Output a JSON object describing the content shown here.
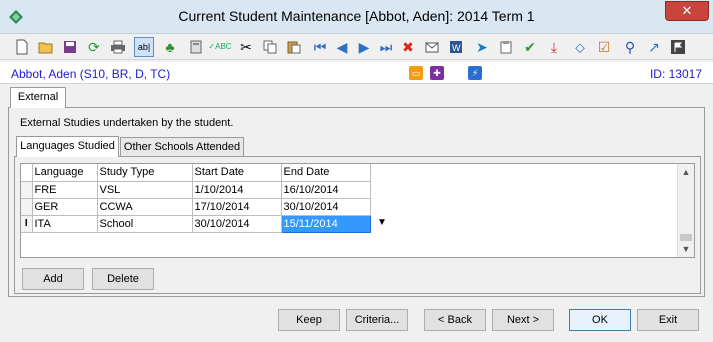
{
  "window": {
    "title": "Current Student Maintenance  [Abbot, Aden]:  2014 Term 1",
    "close_label": "✕"
  },
  "toolbar": {
    "icons": [
      "new-icon",
      "open-icon",
      "save-icon",
      "refresh-icon",
      "print-icon",
      "field-icon",
      "tree-icon",
      "calculator-icon",
      "spellcheck-icon",
      "cut-icon",
      "copy-icon",
      "paste-icon",
      "first-record-icon",
      "previous-record-icon",
      "next-record-icon",
      "last-record-icon",
      "delete-icon",
      "email-icon",
      "word-icon",
      "forward-icon",
      "clipboard-icon",
      "approve-icon",
      "download-icon",
      "tag-icon",
      "checklist-icon",
      "pin-icon",
      "arrow-icon",
      "flag-icon"
    ]
  },
  "student": {
    "name": "Abbot, Aden (S10, BR, D, TC)",
    "id_label": "ID: 13017"
  },
  "outer_tab": "External",
  "description": "External Studies undertaken by the student.",
  "inner_tabs": [
    "Languages Studied",
    "Other Schools Attended"
  ],
  "grid": {
    "columns": [
      "Language",
      "Study Type",
      "Start Date",
      "End Date"
    ],
    "rows": [
      [
        "FRE",
        "VSL",
        "1/10/2014",
        "16/10/2014"
      ],
      [
        "GER",
        "CCWA",
        "17/10/2014",
        "30/10/2014"
      ],
      [
        "ITA",
        "School",
        "30/10/2014",
        "15/11/2014"
      ]
    ],
    "current_row_marker": "I"
  },
  "panel_buttons": {
    "add": "Add",
    "delete": "Delete"
  },
  "footer_buttons": {
    "keep": "Keep",
    "criteria": "Criteria...",
    "back": "< Back",
    "next": "Next >",
    "ok": "OK",
    "exit": "Exit"
  },
  "colors": {
    "accent": "#3399ff",
    "student_text": "#1d1dd0",
    "close": "#c7453a"
  }
}
